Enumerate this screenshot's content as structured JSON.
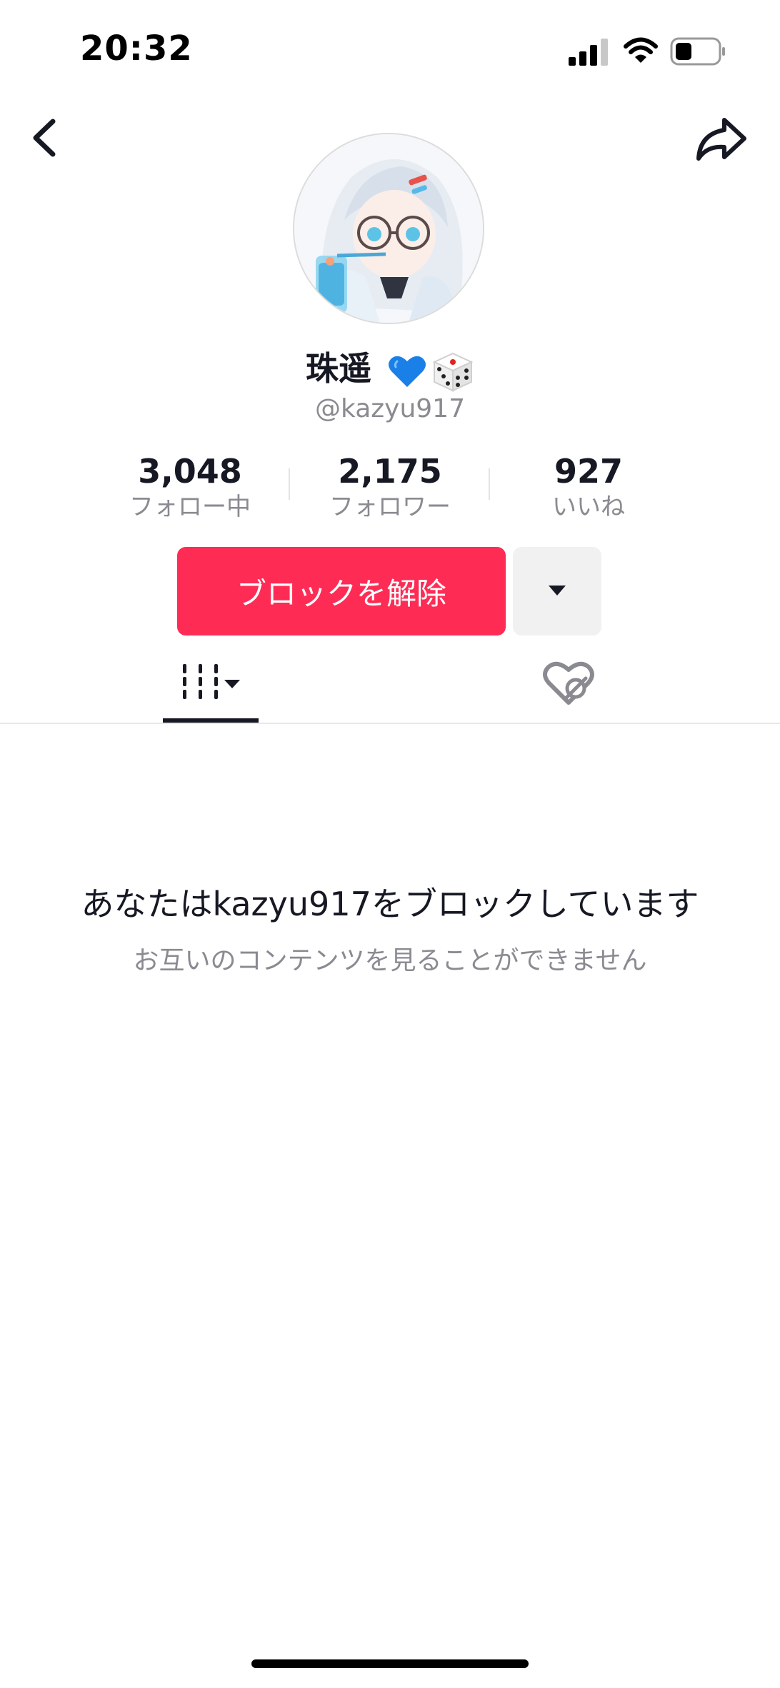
{
  "status_bar": {
    "time": "20:32"
  },
  "profile": {
    "display_name": "珠遥",
    "handle": "@kazyu917",
    "stats": [
      {
        "value": "3,048",
        "label": "フォロー中"
      },
      {
        "value": "2,175",
        "label": "フォロワー"
      },
      {
        "value": "927",
        "label": "いいね"
      }
    ]
  },
  "actions": {
    "unblock_label": "ブロックを解除"
  },
  "blocked": {
    "title": "あなたはkazyu917をブロックしています",
    "subtitle": "お互いのコンテンツを見ることができません"
  },
  "colors": {
    "accent": "#fe2c55",
    "secondary_button": "#f1f1f2",
    "muted_text": "#8a8b91",
    "primary_text": "#161823"
  },
  "icons": [
    "back-icon",
    "share-icon",
    "blue-heart-icon",
    "dice-icon",
    "videos-grid-icon",
    "liked-hidden-icon"
  ]
}
